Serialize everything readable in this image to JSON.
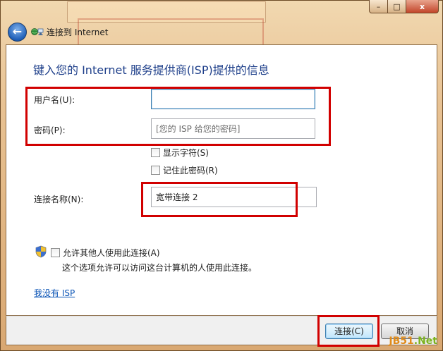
{
  "window": {
    "title": "连接到 Internet",
    "caption_minimize": "–",
    "caption_maximize": "□",
    "caption_close": "x"
  },
  "nav": {
    "back_glyph": "←"
  },
  "heading": "键入您的 Internet 服务提供商(ISP)提供的信息",
  "form": {
    "username_label": "用户名(U):",
    "username_value": "",
    "password_label": "密码(P):",
    "password_placeholder": "[您的 ISP 给您的密码]",
    "show_chars_label": "显示字符(S)",
    "remember_password_label": "记住此密码(R)",
    "connection_name_label": "连接名称(N):",
    "connection_name_value": "宽带连接 2"
  },
  "sharing": {
    "allow_others_label": "允许其他人使用此连接(A)",
    "note": "这个选项允许可以访问这台计算机的人使用此连接。"
  },
  "no_isp_link": "我没有 ISP",
  "buttons": {
    "connect": "连接(C)",
    "cancel": "取消"
  },
  "watermark": {
    "part1": "JB51",
    "part2": ".Net"
  },
  "colors": {
    "heading_blue": "#1e3f8a",
    "link_blue": "#0b54b6",
    "highlight_red": "#d10000",
    "frame_amber": "#e8c293"
  }
}
